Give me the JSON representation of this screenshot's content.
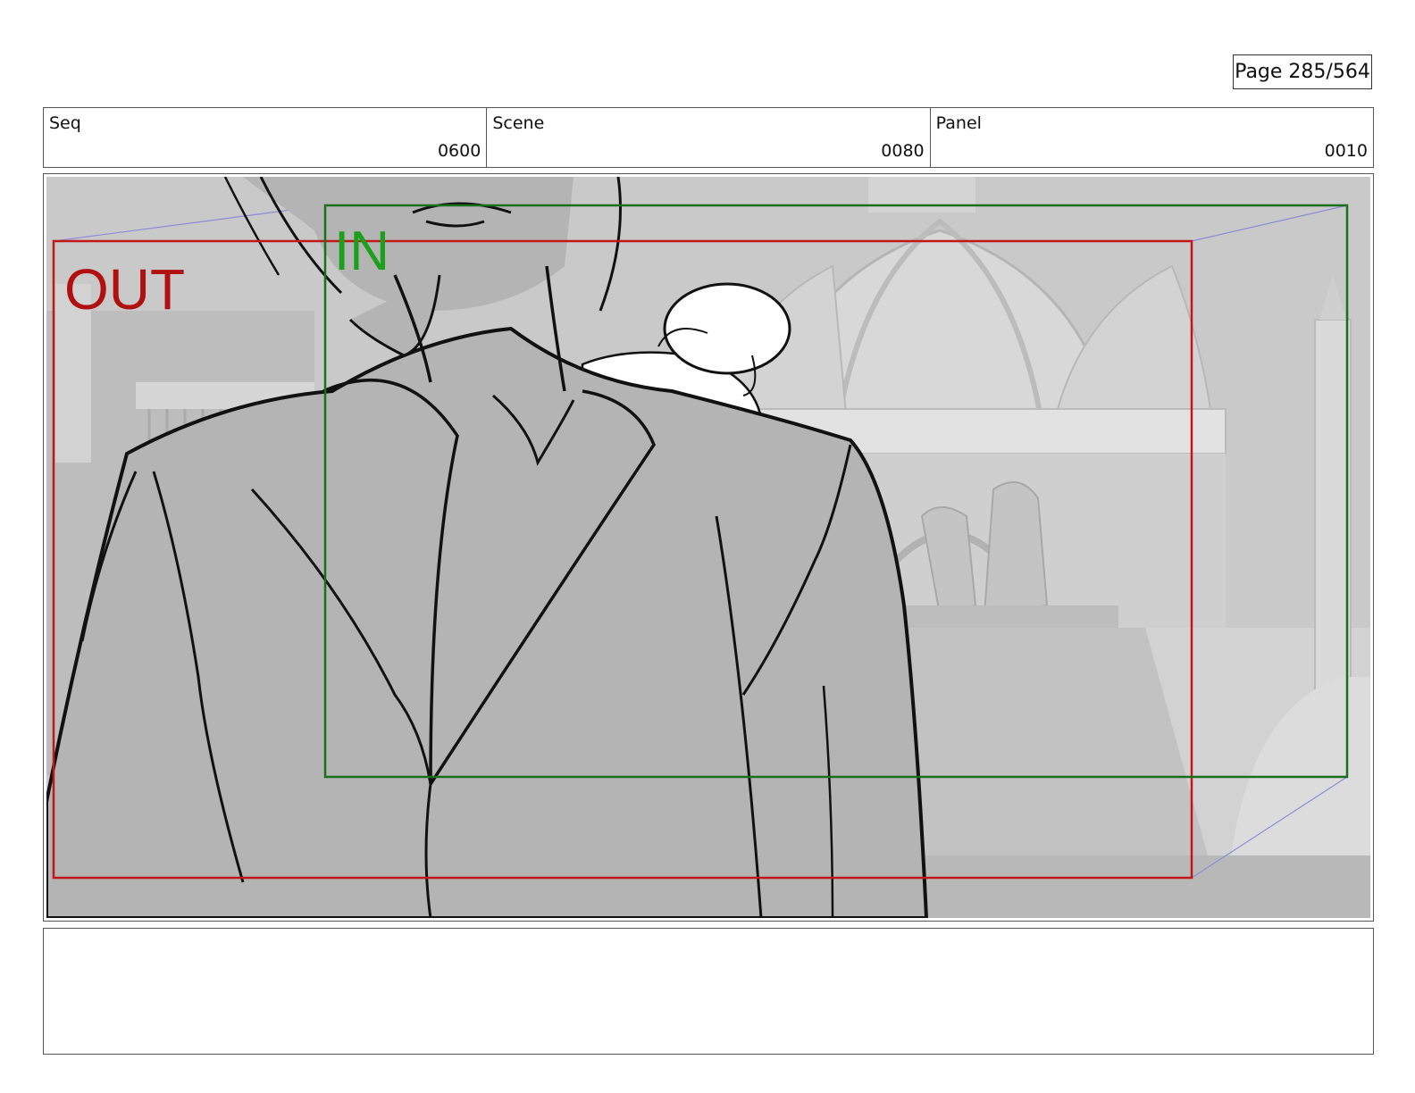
{
  "page": {
    "label": "Page 285/564"
  },
  "header": {
    "seq": {
      "label": "Seq",
      "value": "0600"
    },
    "scene": {
      "label": "Scene",
      "value": "0080"
    },
    "panel": {
      "label": "Panel",
      "value": "0010"
    }
  },
  "frame_guides": {
    "out_label": "OUT",
    "out_color": "#b01010",
    "in_label": "IN",
    "in_color": "#1aa01a"
  },
  "notes": {
    "text": ""
  }
}
